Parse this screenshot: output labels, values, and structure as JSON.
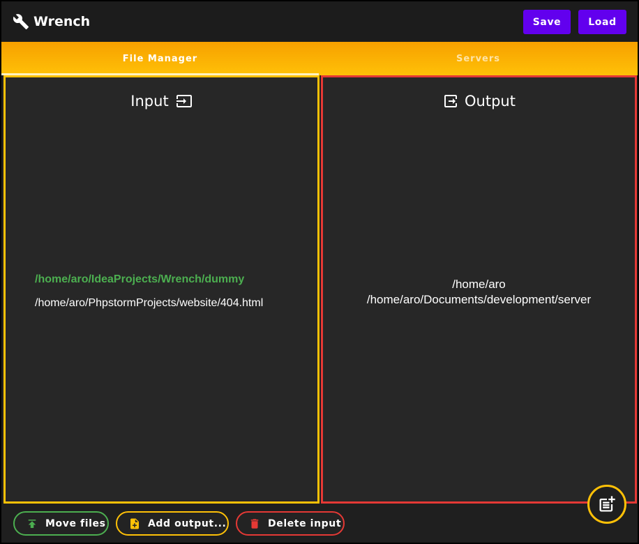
{
  "app": {
    "title": "Wrench"
  },
  "header": {
    "save_label": "Save",
    "load_label": "Load"
  },
  "tabs": [
    {
      "label": "File Manager",
      "active": true
    },
    {
      "label": "Servers",
      "active": false
    }
  ],
  "input_panel": {
    "title": "Input",
    "icon": "input-icon",
    "items": [
      {
        "path": "/home/aro/IdeaProjects/Wrench/dummy",
        "selected": true
      },
      {
        "path": "/home/aro/PhpstormProjects/website/404.html",
        "selected": false
      }
    ]
  },
  "output_panel": {
    "title": "Output",
    "icon": "output-icon",
    "items": [
      {
        "path": "/home/aro"
      },
      {
        "path": "/home/aro/Documents/development/server"
      }
    ]
  },
  "actions": {
    "move_label": "Move files",
    "add_output_label": "Add output...",
    "delete_input_label": "Delete input"
  },
  "colors": {
    "accent": "#ffc107",
    "primary": "#6200ee",
    "success": "#4caf50",
    "danger": "#e53935"
  }
}
